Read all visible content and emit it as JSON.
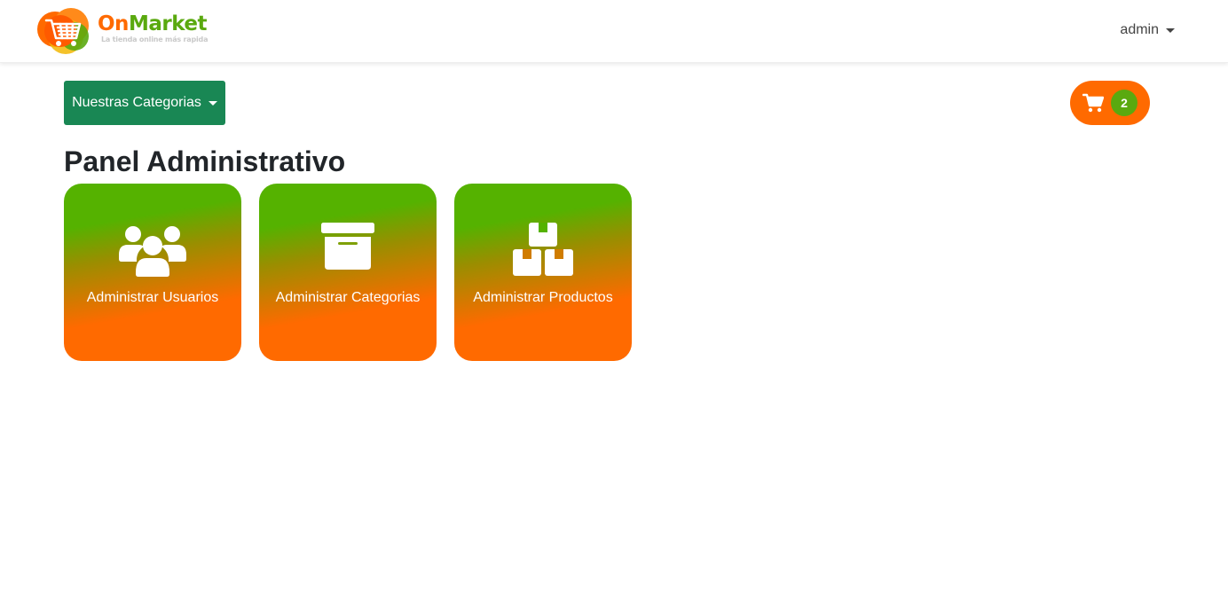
{
  "brand": {
    "name_part1": "On",
    "name_part2": "Market",
    "tagline": "La tienda online más rapida"
  },
  "header": {
    "user_label": "admin"
  },
  "categories_button": {
    "label": "Nuestras Categorias"
  },
  "cart": {
    "count": "2"
  },
  "page": {
    "title": "Panel Administrativo"
  },
  "tiles": [
    {
      "label": "Administrar Usuarios",
      "icon": "users-icon"
    },
    {
      "label": "Administrar Categorias",
      "icon": "archive-box-icon"
    },
    {
      "label": "Administrar Productos",
      "icon": "boxes-icon"
    }
  ],
  "colors": {
    "brand_orange": "#ff6a00",
    "brand_green": "#5aa90f",
    "button_green": "#198754"
  }
}
